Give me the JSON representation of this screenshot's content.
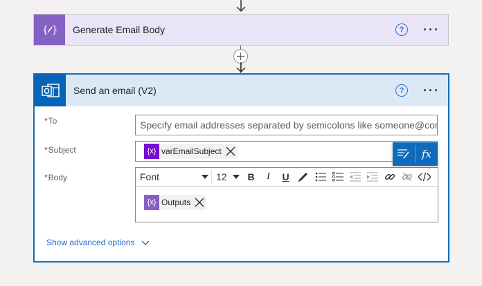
{
  "step1": {
    "title": "Generate Email Body",
    "icon": "variable-icon",
    "accent": "#8661c5"
  },
  "step2": {
    "title": "Send an email (V2)",
    "icon": "outlook-icon",
    "accent": "#0364b8",
    "fields": {
      "to": {
        "label": "To",
        "required_mark": "*",
        "placeholder": "Specify email addresses separated by semicolons like someone@contoso.com"
      },
      "subject": {
        "label": "Subject",
        "required_mark": "*",
        "token_text": "varEmailSubject",
        "token_color": "#770bd6"
      },
      "body": {
        "label": "Body",
        "required_mark": "*",
        "token_text": "Outputs",
        "token_color": "#8661c5"
      }
    },
    "toolbar": {
      "font": "Font",
      "size": "12",
      "bold": "B",
      "italic": "I",
      "underline": "U"
    },
    "show_advanced": "Show advanced options"
  },
  "popup": {
    "fx": "fx"
  }
}
